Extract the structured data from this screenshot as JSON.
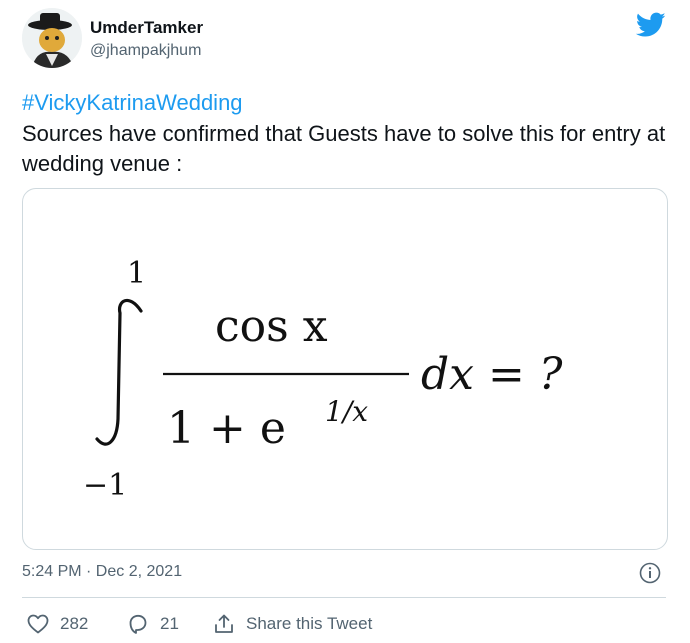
{
  "author": {
    "display_name": "UmderTamker",
    "handle": "@jhampakjhum",
    "avatar_icon": "avatar-cartoon-hat"
  },
  "brand": {
    "icon": "twitter-bird-icon",
    "color": "#1d9bf0"
  },
  "tweet": {
    "hashtag": "#VickyKatrinaWedding",
    "text": "Sources have confirmed that Guests have to solve this for entry at wedding venue :",
    "timestamp": "5:24 PM · Dec 2, 2021"
  },
  "media": {
    "equation": {
      "upper_limit": "1",
      "lower_limit": "−1",
      "numerator": "cos x",
      "denominator_base": "1 + e",
      "denominator_exponent": "1/x",
      "tail": "dx = ?"
    }
  },
  "actions": {
    "like_count": "282",
    "reply_count": "21",
    "share_label": "Share this Tweet"
  },
  "colors": {
    "text": "#0f1419",
    "muted": "#536471",
    "link": "#1d9bf0",
    "border": "#cfd9de"
  }
}
